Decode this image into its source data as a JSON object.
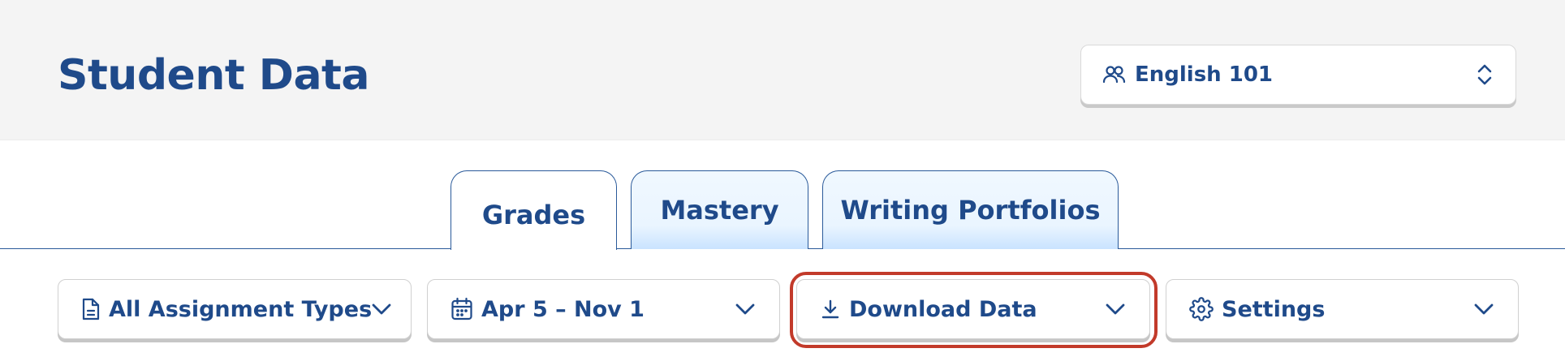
{
  "header": {
    "title": "Student Data",
    "course_selector": {
      "label": "English 101",
      "icon": "users-icon",
      "caret_icon": "updown-chevron-icon"
    }
  },
  "tabs": [
    {
      "label": "Grades",
      "active": true
    },
    {
      "label": "Mastery",
      "active": false
    },
    {
      "label": "Writing Portfolios",
      "active": false
    }
  ],
  "filters": {
    "assignment_types": {
      "label": "All Assignment Types",
      "icon": "document-icon"
    },
    "date_range": {
      "label": "Apr 5 – Nov 1",
      "icon": "calendar-icon"
    },
    "download": {
      "label": "Download Data",
      "icon": "download-icon"
    },
    "settings": {
      "label": "Settings",
      "icon": "gear-icon"
    }
  },
  "colors": {
    "brand": "#1f4a8a",
    "header_bg": "#f4f4f4",
    "tab_inactive_bg": "#eaf5ff",
    "highlight": "#c23a2a"
  }
}
